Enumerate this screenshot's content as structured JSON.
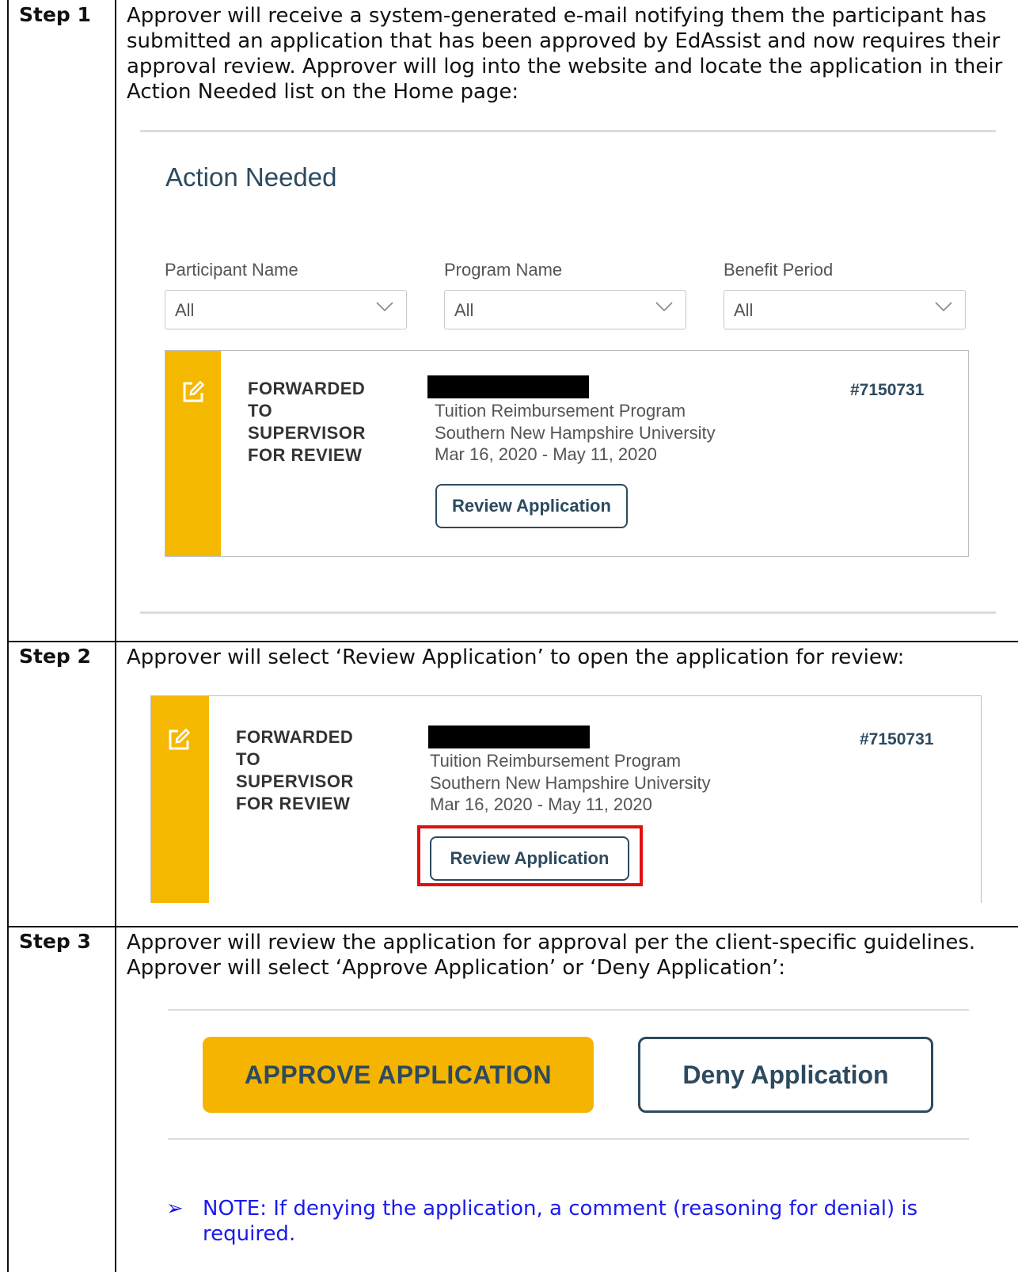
{
  "steps": [
    {
      "label": "Step 1",
      "text": "Approver will receive a system-generated e-mail notifying them the participant has submitted an application that has been approved by EdAssist and now requires their approval review. Approver will log into the website and locate the application in their Action Needed list on the Home page:"
    },
    {
      "label": "Step 2",
      "text": "Approver will select ‘Review Application’ to open the application for review:"
    },
    {
      "label": "Step 3",
      "text": "Approver will review the application for approval per the client-specific guidelines. Approver will select ‘Approve Application’ or ‘Deny Application’:"
    }
  ],
  "action_needed": {
    "title": "Action Needed",
    "filters": [
      {
        "label": "Participant Name",
        "value": "All"
      },
      {
        "label": "Program Name",
        "value": "All"
      },
      {
        "label": "Benefit Period",
        "value": "All"
      }
    ]
  },
  "application_card": {
    "status_lines": [
      "FORWARDED",
      "TO",
      "SUPERVISOR",
      "FOR REVIEW"
    ],
    "program": "Tuition Reimbursement Program",
    "school": "Southern New Hampshire University",
    "dates": "Mar 16, 2020 - May 11, 2020",
    "app_id": "#7150731",
    "review_button": "Review Application"
  },
  "decision": {
    "approve_label": "APPROVE APPLICATION",
    "deny_label": "Deny Application"
  },
  "note": {
    "arrow": "➢",
    "text": "NOTE: If denying the application, a comment (reasoning for denial) is required."
  },
  "colors": {
    "accent_yellow": "#f5b800",
    "navy": "#2d4a5e",
    "highlight_red": "#e01010",
    "note_blue": "#1a1aee"
  },
  "icons": {
    "edit": "edit-icon",
    "chevron": "chevron-down-icon"
  }
}
